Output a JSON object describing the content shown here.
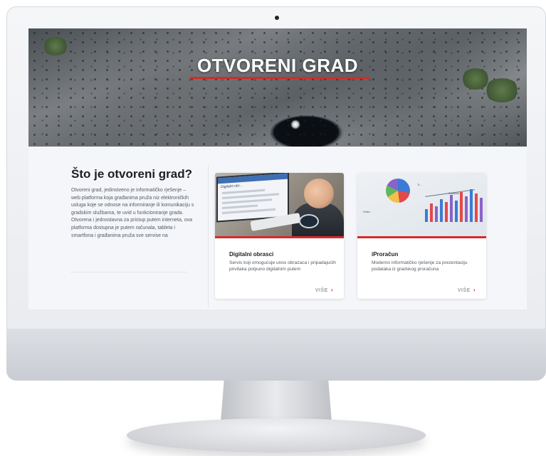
{
  "hero": {
    "title": "OTVORENI GRAD"
  },
  "intro": {
    "title": "Što je otvoreni grad?",
    "text": "Otvoreni grad, jedinstveno je informatičko rješenje – web platforma koja građanima pruža niz elektroničkih usluga koje se odnose na informiranje ili komunikaciju s gradskim službama, te uvid u funkcioniranje grada. Otvorena i jednostavna za pristup putem interneta, ova platforma dostupna je putem računala, tableta i smartfona i građanima pruža sve servise na"
  },
  "cards": [
    {
      "title": "Digitalni obrasci",
      "text": "Servis koji omogućuje unos obrazaca i pripadajućih privitaka potpuno digitalnim putem",
      "more": "VIŠE",
      "image_text": "Digitalni obr..."
    },
    {
      "title": "iProračun",
      "text": "Moderno informatičko rješenje za prezentaciju podataka iz gradskog proračuna",
      "more": "VIŠE",
      "image_labels": [
        "Analysis",
        "Sales",
        "Tr..."
      ]
    }
  ],
  "colors": {
    "accent": "#d42a2a",
    "page_bg": "#f4f6f9",
    "heading": "#1c1f24",
    "body_text": "#555a60"
  },
  "icons": {
    "more_chevron": "chevron-right-icon"
  }
}
